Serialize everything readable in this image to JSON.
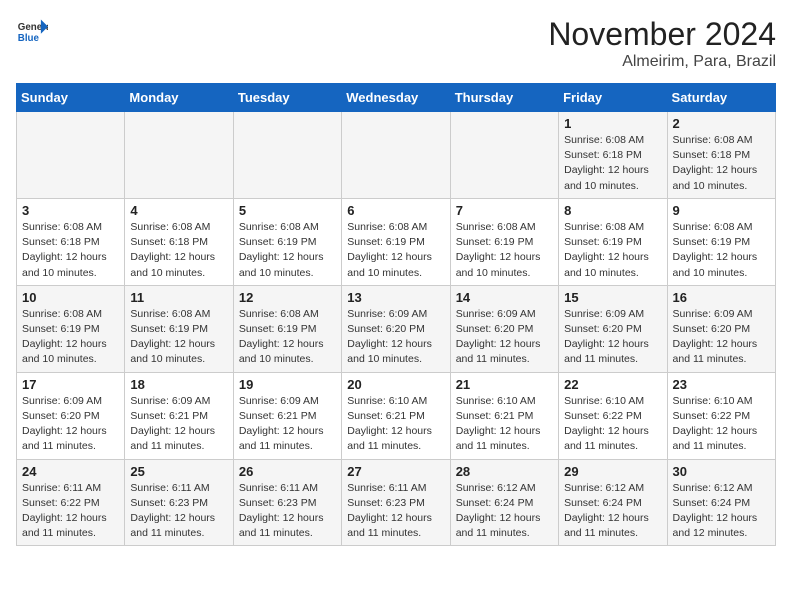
{
  "header": {
    "logo_general": "General",
    "logo_blue": "Blue",
    "month_title": "November 2024",
    "location": "Almeirim, Para, Brazil"
  },
  "weekdays": [
    "Sunday",
    "Monday",
    "Tuesday",
    "Wednesday",
    "Thursday",
    "Friday",
    "Saturday"
  ],
  "weeks": [
    [
      {
        "day": "",
        "info": ""
      },
      {
        "day": "",
        "info": ""
      },
      {
        "day": "",
        "info": ""
      },
      {
        "day": "",
        "info": ""
      },
      {
        "day": "",
        "info": ""
      },
      {
        "day": "1",
        "info": "Sunrise: 6:08 AM\nSunset: 6:18 PM\nDaylight: 12 hours and 10 minutes."
      },
      {
        "day": "2",
        "info": "Sunrise: 6:08 AM\nSunset: 6:18 PM\nDaylight: 12 hours and 10 minutes."
      }
    ],
    [
      {
        "day": "3",
        "info": "Sunrise: 6:08 AM\nSunset: 6:18 PM\nDaylight: 12 hours and 10 minutes."
      },
      {
        "day": "4",
        "info": "Sunrise: 6:08 AM\nSunset: 6:18 PM\nDaylight: 12 hours and 10 minutes."
      },
      {
        "day": "5",
        "info": "Sunrise: 6:08 AM\nSunset: 6:19 PM\nDaylight: 12 hours and 10 minutes."
      },
      {
        "day": "6",
        "info": "Sunrise: 6:08 AM\nSunset: 6:19 PM\nDaylight: 12 hours and 10 minutes."
      },
      {
        "day": "7",
        "info": "Sunrise: 6:08 AM\nSunset: 6:19 PM\nDaylight: 12 hours and 10 minutes."
      },
      {
        "day": "8",
        "info": "Sunrise: 6:08 AM\nSunset: 6:19 PM\nDaylight: 12 hours and 10 minutes."
      },
      {
        "day": "9",
        "info": "Sunrise: 6:08 AM\nSunset: 6:19 PM\nDaylight: 12 hours and 10 minutes."
      }
    ],
    [
      {
        "day": "10",
        "info": "Sunrise: 6:08 AM\nSunset: 6:19 PM\nDaylight: 12 hours and 10 minutes."
      },
      {
        "day": "11",
        "info": "Sunrise: 6:08 AM\nSunset: 6:19 PM\nDaylight: 12 hours and 10 minutes."
      },
      {
        "day": "12",
        "info": "Sunrise: 6:08 AM\nSunset: 6:19 PM\nDaylight: 12 hours and 10 minutes."
      },
      {
        "day": "13",
        "info": "Sunrise: 6:09 AM\nSunset: 6:20 PM\nDaylight: 12 hours and 10 minutes."
      },
      {
        "day": "14",
        "info": "Sunrise: 6:09 AM\nSunset: 6:20 PM\nDaylight: 12 hours and 11 minutes."
      },
      {
        "day": "15",
        "info": "Sunrise: 6:09 AM\nSunset: 6:20 PM\nDaylight: 12 hours and 11 minutes."
      },
      {
        "day": "16",
        "info": "Sunrise: 6:09 AM\nSunset: 6:20 PM\nDaylight: 12 hours and 11 minutes."
      }
    ],
    [
      {
        "day": "17",
        "info": "Sunrise: 6:09 AM\nSunset: 6:20 PM\nDaylight: 12 hours and 11 minutes."
      },
      {
        "day": "18",
        "info": "Sunrise: 6:09 AM\nSunset: 6:21 PM\nDaylight: 12 hours and 11 minutes."
      },
      {
        "day": "19",
        "info": "Sunrise: 6:09 AM\nSunset: 6:21 PM\nDaylight: 12 hours and 11 minutes."
      },
      {
        "day": "20",
        "info": "Sunrise: 6:10 AM\nSunset: 6:21 PM\nDaylight: 12 hours and 11 minutes."
      },
      {
        "day": "21",
        "info": "Sunrise: 6:10 AM\nSunset: 6:21 PM\nDaylight: 12 hours and 11 minutes."
      },
      {
        "day": "22",
        "info": "Sunrise: 6:10 AM\nSunset: 6:22 PM\nDaylight: 12 hours and 11 minutes."
      },
      {
        "day": "23",
        "info": "Sunrise: 6:10 AM\nSunset: 6:22 PM\nDaylight: 12 hours and 11 minutes."
      }
    ],
    [
      {
        "day": "24",
        "info": "Sunrise: 6:11 AM\nSunset: 6:22 PM\nDaylight: 12 hours and 11 minutes."
      },
      {
        "day": "25",
        "info": "Sunrise: 6:11 AM\nSunset: 6:23 PM\nDaylight: 12 hours and 11 minutes."
      },
      {
        "day": "26",
        "info": "Sunrise: 6:11 AM\nSunset: 6:23 PM\nDaylight: 12 hours and 11 minutes."
      },
      {
        "day": "27",
        "info": "Sunrise: 6:11 AM\nSunset: 6:23 PM\nDaylight: 12 hours and 11 minutes."
      },
      {
        "day": "28",
        "info": "Sunrise: 6:12 AM\nSunset: 6:24 PM\nDaylight: 12 hours and 11 minutes."
      },
      {
        "day": "29",
        "info": "Sunrise: 6:12 AM\nSunset: 6:24 PM\nDaylight: 12 hours and 11 minutes."
      },
      {
        "day": "30",
        "info": "Sunrise: 6:12 AM\nSunset: 6:24 PM\nDaylight: 12 hours and 12 minutes."
      }
    ]
  ]
}
